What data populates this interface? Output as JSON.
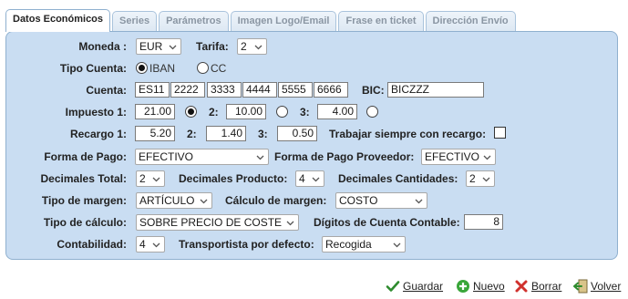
{
  "tabs": [
    {
      "label": "Datos Económicos",
      "active": true
    },
    {
      "label": "Series"
    },
    {
      "label": "Parámetros"
    },
    {
      "label": "Imagen Logo/Email"
    },
    {
      "label": "Frase en ticket"
    },
    {
      "label": "Dirección Envío"
    }
  ],
  "form": {
    "moneda": {
      "label": "Moneda :",
      "value": "EUR"
    },
    "tarifa": {
      "label": "Tarifa:",
      "value": "2"
    },
    "tipo_cuenta": {
      "label": "Tipo Cuenta:",
      "iban": "IBAN",
      "cc": "CC",
      "selected": "IBAN"
    },
    "cuenta": {
      "label": "Cuenta:",
      "parts": [
        "ES11",
        "2222",
        "3333",
        "4444",
        "5555",
        "6666"
      ]
    },
    "bic": {
      "label": "BIC:",
      "value": "BICZZZ"
    },
    "impuesto": {
      "label": "Impuesto 1:",
      "v1": "21.00",
      "l2": "2:",
      "v2": "10.00",
      "l3": "3:",
      "v3": "4.00",
      "selected": 1
    },
    "recargo": {
      "label": "Recargo 1:",
      "v1": "5.20",
      "l2": "2:",
      "v2": "1.40",
      "l3": "3:",
      "v3": "0.50",
      "siempre_label": "Trabajar siempre con recargo:",
      "siempre_checked": false
    },
    "forma_pago": {
      "label": "Forma de Pago:",
      "value": "EFECTIVO"
    },
    "forma_pago_prov": {
      "label": "Forma de Pago Proveedor:",
      "value": "EFECTIVO"
    },
    "dec_total": {
      "label": "Decimales Total:",
      "value": "2"
    },
    "dec_producto": {
      "label": "Decimales Producto:",
      "value": "4"
    },
    "dec_cantidades": {
      "label": "Decimales Cantidades:",
      "value": "2"
    },
    "tipo_margen": {
      "label": "Tipo de margen:",
      "value": "ARTÍCULO"
    },
    "calculo_margen": {
      "label": "Cálculo de margen:",
      "value": "COSTO"
    },
    "tipo_calculo": {
      "label": "Tipo de cálculo:",
      "value": "SOBRE PRECIO DE COSTE"
    },
    "digitos": {
      "label": "Dígitos de Cuenta Contable:",
      "value": "8"
    },
    "contabilidad": {
      "label": "Contabilidad:",
      "value": "4"
    },
    "transportista": {
      "label": "Transportista por defecto:",
      "value": "Recogida"
    }
  },
  "actions": {
    "guardar": "Guardar",
    "nuevo": "Nuevo",
    "borrar": "Borrar",
    "volver": "Volver"
  },
  "colors": {
    "panel": "#c9ddf2",
    "border": "#8fb0cf",
    "save_green": "#2e8b2e",
    "delete_red": "#d0312d"
  }
}
